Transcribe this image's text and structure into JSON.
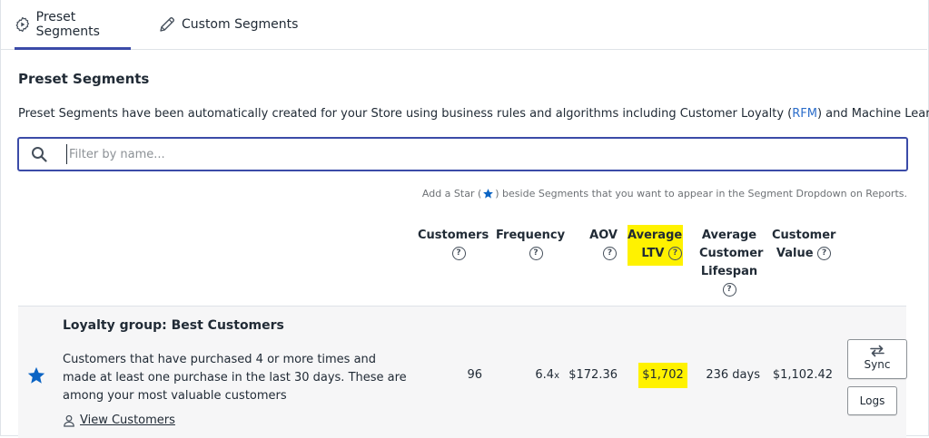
{
  "tabs": [
    {
      "label": "Preset Segments",
      "icon": "gear-play-icon",
      "active": true
    },
    {
      "label": "Custom Segments",
      "icon": "pencil-icon",
      "active": false
    }
  ],
  "section": {
    "title": "Preset Segments",
    "description_pre": "Preset Segments have been automatically created for your Store using business rules and algorithms including Customer Loyalty (",
    "description_link": "RFM",
    "description_post": ") and Machine Learning."
  },
  "search": {
    "placeholder": "Filter by name...",
    "value": ""
  },
  "hint": {
    "pre": "Add a Star (",
    "post": ") beside Segments that you want to appear in the Segment Dropdown on Reports."
  },
  "columns": {
    "customers": "Customers",
    "frequency": "Frequency",
    "aov": "AOV",
    "ltv_line1": "Average",
    "ltv_line2": "LTV",
    "lifespan_line1": "Average",
    "lifespan_line2": "Customer",
    "lifespan_line3": "Lifespan",
    "value_line1": "Customer",
    "value_line2": "Value"
  },
  "rows": [
    {
      "title": "Loyalty group: Best Customers",
      "description": "Customers that have purchased 4 or more times and made at least one purchase in the last 30 days. These are among your most valuable customers",
      "view_label": "View Customers",
      "customers": "96",
      "frequency": "6.4",
      "frequency_suffix": "x",
      "aov": "$172.36",
      "ltv": "$1,702",
      "lifespan": "236 days",
      "value": "$1,102.42",
      "sync_label": "Sync",
      "logs_label": "Logs",
      "starred": true
    }
  ],
  "colors": {
    "accent": "#3b4ba8",
    "star": "#0b64c4",
    "highlight": "#fff200",
    "link": "#2c6ecb"
  }
}
